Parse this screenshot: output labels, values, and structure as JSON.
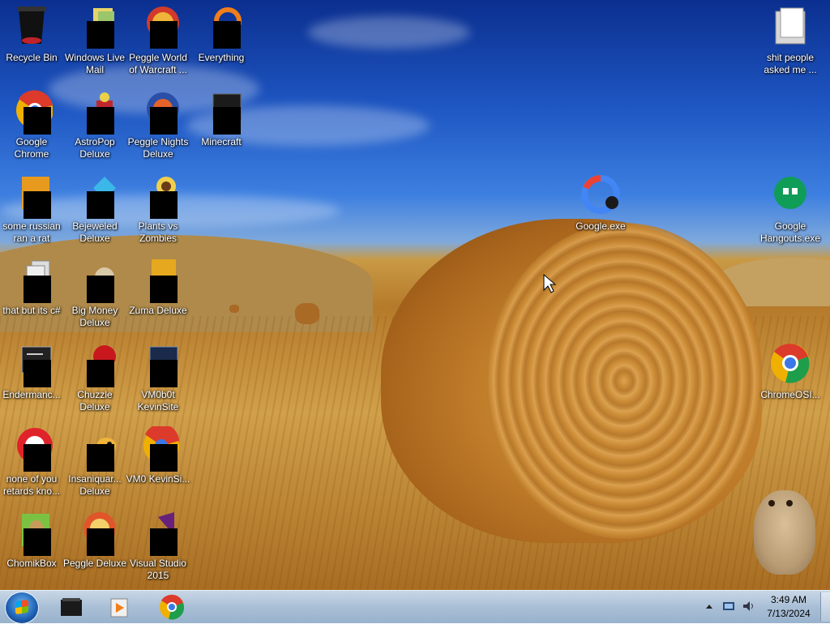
{
  "desktop": {
    "icons": [
      {
        "label": "Recycle Bin"
      },
      {
        "label": "Windows Live Mail"
      },
      {
        "label": "Peggle World of Warcraft ..."
      },
      {
        "label": "Everything"
      },
      {
        "label": "Google Chrome"
      },
      {
        "label": "AstroPop Deluxe"
      },
      {
        "label": "Peggle Nights Deluxe"
      },
      {
        "label": "Minecraft"
      },
      {
        "label": "some russian ran a rat"
      },
      {
        "label": "Bejeweled Deluxe"
      },
      {
        "label": "Plants vs Zombies"
      },
      {
        "label": "that but its c#"
      },
      {
        "label": "Big Money Deluxe"
      },
      {
        "label": "Zuma Deluxe"
      },
      {
        "label": "Endermanc..."
      },
      {
        "label": "Chuzzle Deluxe"
      },
      {
        "label": "VM0b0t KevinSite"
      },
      {
        "label": "none of you retards kno..."
      },
      {
        "label": "Insaniquar... Deluxe"
      },
      {
        "label": "VM0 KevinSi..."
      },
      {
        "label": "ChomikBox"
      },
      {
        "label": "Peggle Deluxe"
      },
      {
        "label": "Visual Studio 2015"
      },
      {
        "label": "shit people asked me ..."
      },
      {
        "label": "Google.exe"
      },
      {
        "label": "Google Hangouts.exe"
      },
      {
        "label": "ChromeOSI..."
      }
    ]
  },
  "taskbar": {
    "pinned": [
      {
        "icon": "black-app-icon"
      },
      {
        "icon": "media-player-icon"
      },
      {
        "icon": "chrome-icon"
      }
    ],
    "clock": {
      "time": "3:49 AM",
      "date": "7/13/2024"
    }
  }
}
